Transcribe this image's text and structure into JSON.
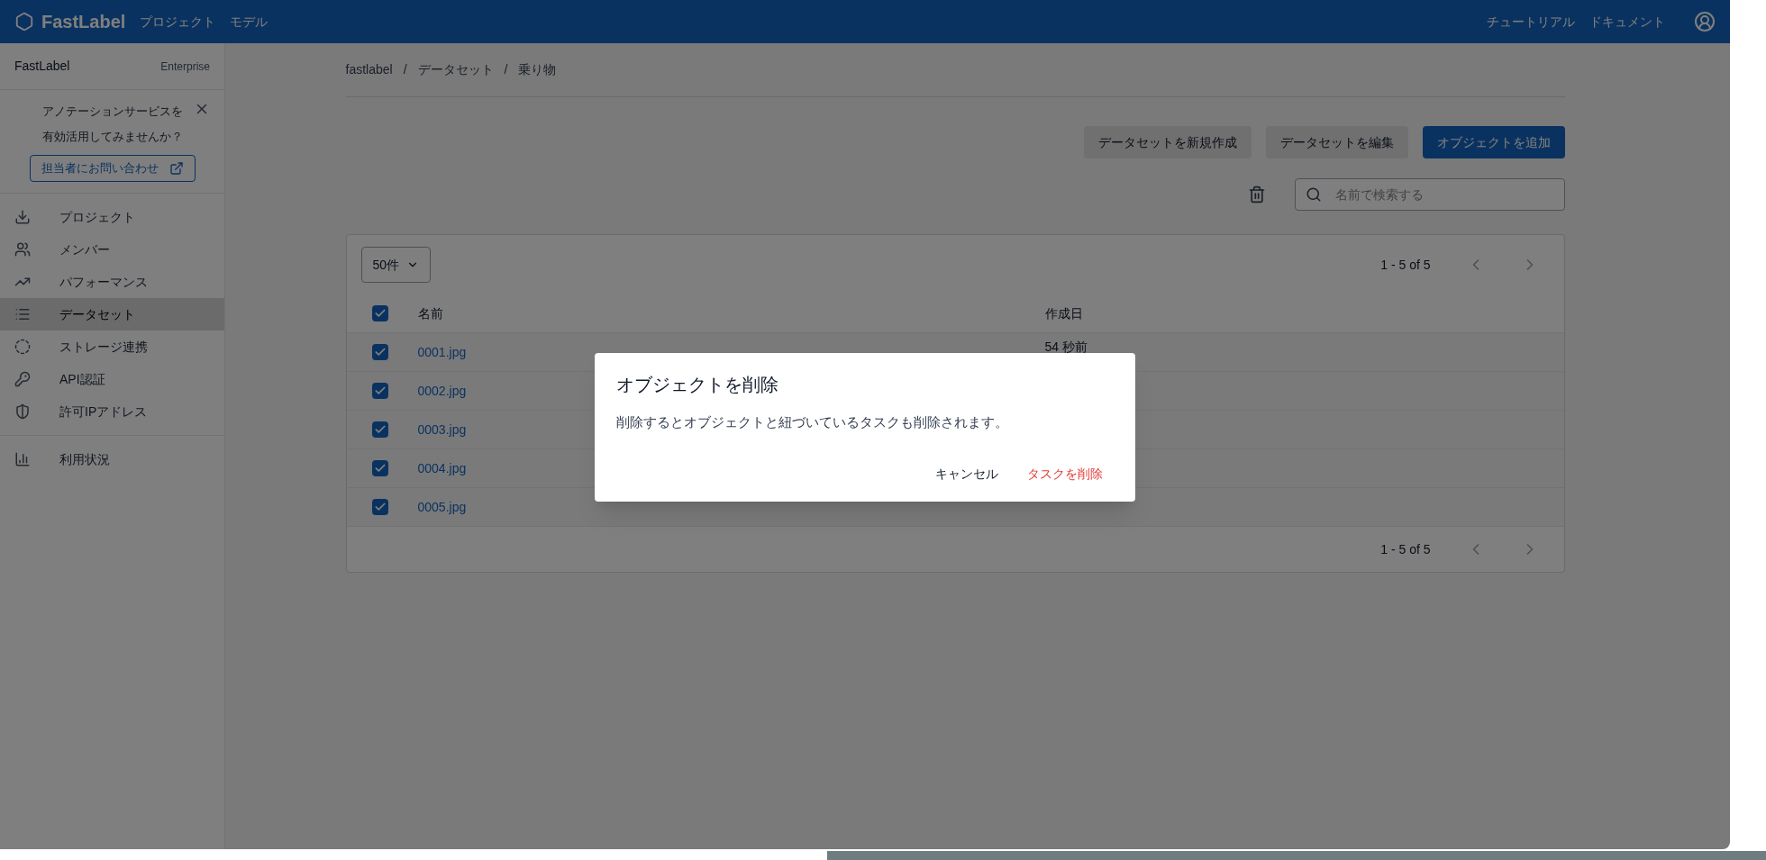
{
  "header": {
    "brand": "FastLabel",
    "nav": [
      "プロジェクト",
      "モデル"
    ],
    "right_links": [
      "チュートリアル",
      "ドキュメント"
    ]
  },
  "sidebar": {
    "org": "FastLabel",
    "plan": "Enterprise",
    "promo": {
      "lines": [
        "アノテーションサービスを",
        "有効活用してみませんか？"
      ],
      "button": "担当者にお問い合わせ"
    },
    "items": [
      {
        "kind": "project",
        "label": "プロジェクト",
        "selected": false
      },
      {
        "kind": "members",
        "label": "メンバー",
        "selected": false
      },
      {
        "kind": "performance",
        "label": "パフォーマンス",
        "selected": false
      },
      {
        "kind": "dataset",
        "label": "データセット",
        "selected": true
      },
      {
        "kind": "storage",
        "label": "ストレージ連携",
        "selected": false
      },
      {
        "kind": "api",
        "label": "API認証",
        "selected": false
      },
      {
        "kind": "ip",
        "label": "許可IPアドレス",
        "selected": false
      }
    ],
    "bottom_items": [
      {
        "kind": "usage",
        "label": "利用状況",
        "selected": false
      }
    ]
  },
  "breadcrumb": {
    "items": [
      "fastlabel",
      "データセット",
      "乗り物"
    ],
    "separators": [
      "/",
      "/"
    ]
  },
  "actions": [
    {
      "label": "データセットを新規作成",
      "kind": "secondary"
    },
    {
      "label": "データセットを編集",
      "kind": "secondary"
    },
    {
      "label": "オブジェクトを追加",
      "kind": "primary"
    }
  ],
  "search": {
    "placeholder": "名前で検索する"
  },
  "table": {
    "page_size": "50件",
    "range_top": "1 - 5 of 5",
    "range_bottom": "1 - 5 of 5",
    "all_checked": true,
    "columns": [
      "名前",
      "作成日"
    ],
    "rows": [
      {
        "name": "0001.jpg",
        "created": "54 秒前",
        "checked": true
      },
      {
        "name": "0002.jpg",
        "checked": true
      },
      {
        "name": "0003.jpg",
        "checked": true
      },
      {
        "name": "0004.jpg",
        "checked": true
      },
      {
        "name": "0005.jpg",
        "checked": true
      }
    ]
  },
  "dialog": {
    "title": "オブジェクトを削除",
    "message": "削除するとオブジェクトと紐づいているタスクも削除されます。",
    "cancel": "キャンセル",
    "confirm": "タスクを削除"
  }
}
